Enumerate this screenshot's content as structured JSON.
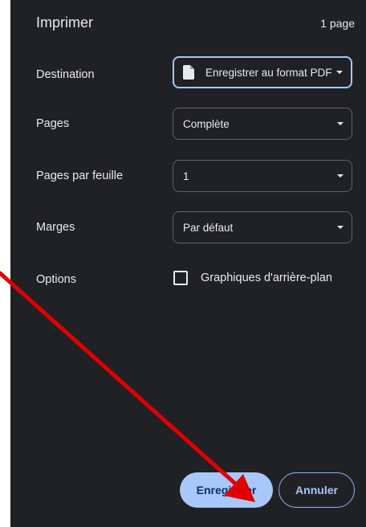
{
  "header": {
    "title": "Imprimer",
    "page_count": "1 page"
  },
  "settings": {
    "destination": {
      "label": "Destination",
      "value": "Enregistrer au format PDF",
      "icon": "document-icon"
    },
    "pages": {
      "label": "Pages",
      "value": "Complète"
    },
    "pages_per_sheet": {
      "label": "Pages par feuille",
      "value": "1"
    },
    "margins": {
      "label": "Marges",
      "value": "Par défaut"
    },
    "options": {
      "label": "Options",
      "background_graphics_label": "Graphiques d'arrière-plan",
      "background_graphics_checked": false
    }
  },
  "actions": {
    "save_label": "Enregistrer",
    "cancel_label": "Annuler"
  },
  "colors": {
    "panel_bg": "#202124",
    "primary_button_bg": "#a8c7fa",
    "focus_border": "#a8c7fa",
    "annotation_arrow": "#e00000"
  }
}
